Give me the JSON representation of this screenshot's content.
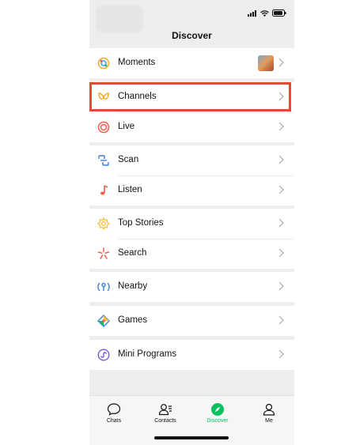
{
  "colors": {
    "accent": "#07c160",
    "highlight": "#e24a32",
    "background": "#ededed"
  },
  "header": {
    "title": "Discover"
  },
  "groups": [
    {
      "items": [
        {
          "label": "Moments",
          "icon": "moments-icon"
        }
      ]
    },
    {
      "items": [
        {
          "label": "Channels",
          "icon": "channels-icon"
        },
        {
          "label": "Live",
          "icon": "live-icon"
        }
      ]
    },
    {
      "items": [
        {
          "label": "Scan",
          "icon": "scan-icon"
        },
        {
          "label": "Listen",
          "icon": "music-note-icon"
        }
      ]
    },
    {
      "items": [
        {
          "label": "Top Stories",
          "icon": "top-stories-icon"
        },
        {
          "label": "Search",
          "icon": "search-icon"
        }
      ]
    },
    {
      "items": [
        {
          "label": "Nearby",
          "icon": "nearby-icon"
        }
      ]
    },
    {
      "items": [
        {
          "label": "Games",
          "icon": "games-icon"
        }
      ]
    },
    {
      "items": [
        {
          "label": "Mini Programs",
          "icon": "mini-programs-icon"
        }
      ]
    }
  ],
  "tabbar": {
    "tabs": [
      {
        "label": "Chats",
        "icon": "chat-bubble-icon"
      },
      {
        "label": "Contacts",
        "icon": "contacts-icon"
      },
      {
        "label": "Discover",
        "icon": "compass-icon",
        "active": true
      },
      {
        "label": "Me",
        "icon": "person-icon"
      }
    ]
  }
}
